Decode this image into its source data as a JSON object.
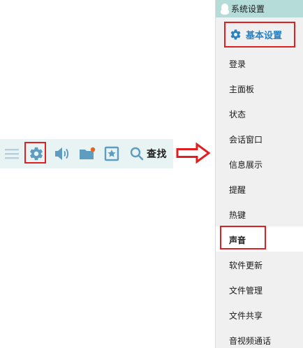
{
  "toolbar": {
    "search_label": "查找",
    "icons": [
      "menu-icon",
      "gear-icon",
      "speaker-icon",
      "message-box-icon",
      "star-icon",
      "search-icon"
    ],
    "accent_color": "#6fa8c8",
    "notification_color": "#e8641e"
  },
  "highlight_color": "#e02020",
  "settings_panel": {
    "title": "系统设置",
    "basic_tab_label": "基本设置",
    "selected_item": "声音",
    "items": [
      {
        "label": "登录"
      },
      {
        "label": "主面板"
      },
      {
        "label": "状态"
      },
      {
        "label": "会话窗口"
      },
      {
        "label": "信息展示"
      },
      {
        "label": "提醒"
      },
      {
        "label": "热键"
      },
      {
        "label": "声音"
      },
      {
        "label": "软件更新"
      },
      {
        "label": "文件管理"
      },
      {
        "label": "文件共享"
      },
      {
        "label": "音视频通话"
      }
    ]
  }
}
